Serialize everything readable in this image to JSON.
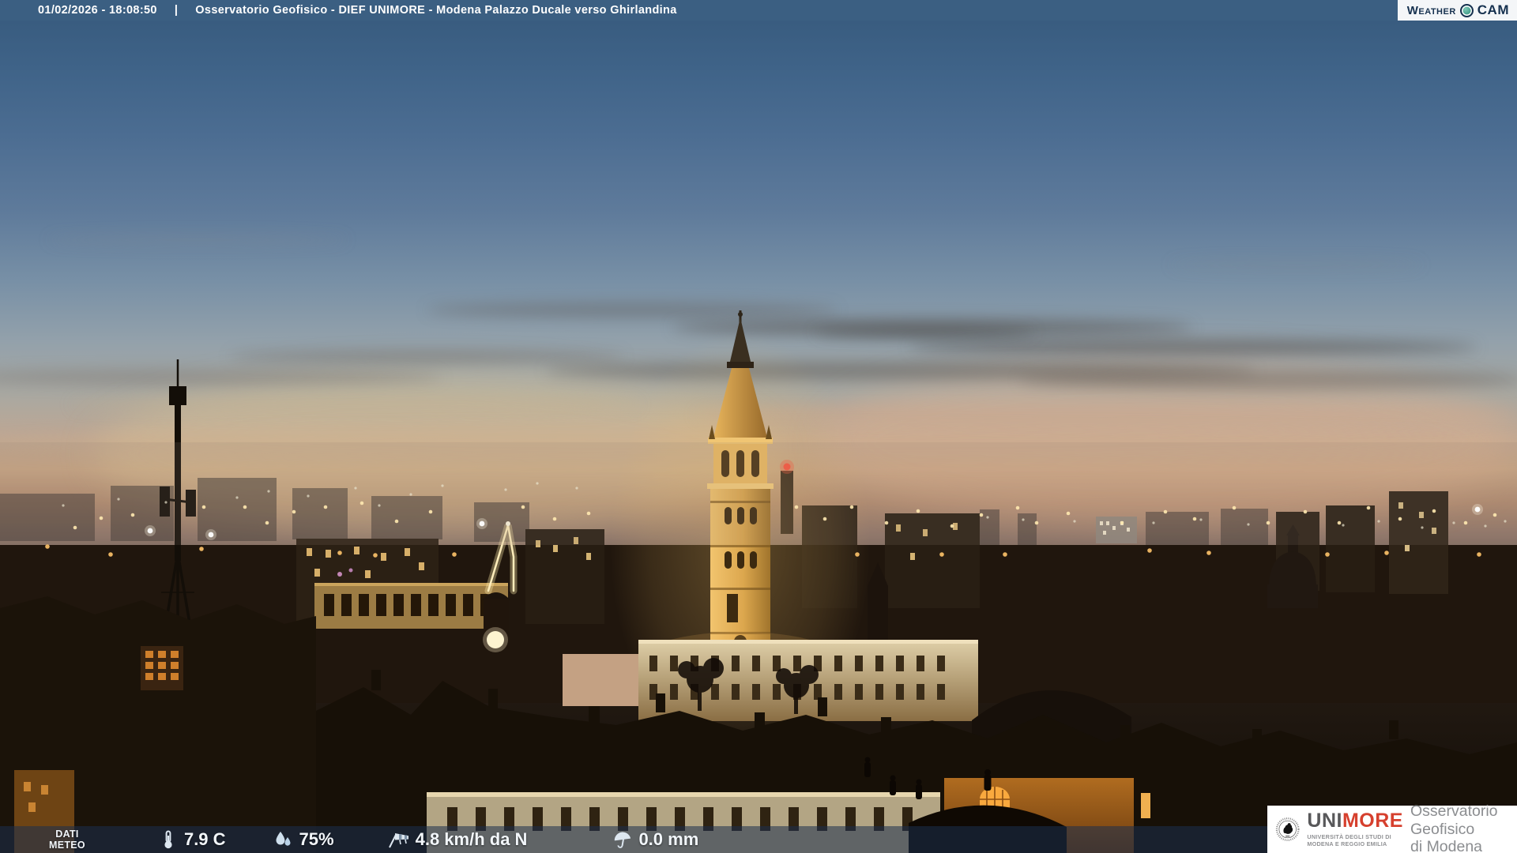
{
  "theme": {
    "header-bar": "#3b5f82",
    "header-text": "#ffffff",
    "brand-navy": "#16314f",
    "brand-teal": "#4aa390",
    "unimore-red": "#d6402e",
    "logo-gray": "#58585a",
    "obs-text": "#8b8d90",
    "footer-bar": "rgba(28,48,78,0.55)",
    "footer-text": "#f2f6fa"
  },
  "header": {
    "timestamp": "01/02/2026 - 18:08:50",
    "separator": "|",
    "title": "Osservatorio Geofisico - DIEF UNIMORE - Modena Palazzo Ducale verso Ghirlandina",
    "brand_weather": "Weather",
    "brand_cam": "CAM"
  },
  "footer": {
    "label_line1": "DATI",
    "label_line2": "METEO",
    "metrics": [
      {
        "name": "temperature",
        "value": "7.9 C"
      },
      {
        "name": "humidity",
        "value": "75%"
      },
      {
        "name": "wind",
        "value": "4.8 km/h da N"
      },
      {
        "name": "precipitation",
        "value": "0.0 mm"
      }
    ]
  },
  "logo_box": {
    "uni": "UNI",
    "more": "MORE",
    "subtitle_line1": "UNIVERSITÀ DEGLI STUDI DI",
    "subtitle_line2": "MODENA E REGGIO EMILIA",
    "right_line1": "Osservatorio Geofisico",
    "right_line2": "di Modena"
  }
}
